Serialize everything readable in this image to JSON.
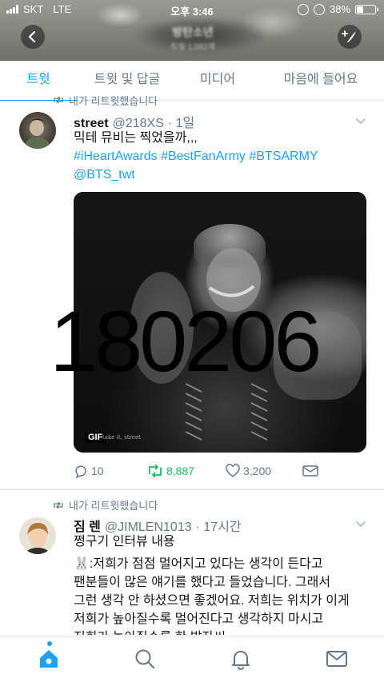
{
  "status_bar": {
    "carrier": "SKT",
    "network": "LTE",
    "time": "오후 3:46",
    "battery": "38%",
    "battery_level": 0.38
  },
  "header": {
    "title": "방탄소년",
    "subtitle": "트윗 1,082개"
  },
  "tabs": [
    {
      "label": "트윗",
      "active": true
    },
    {
      "label": "트윗 및 답글",
      "active": false
    },
    {
      "label": "미디어",
      "active": false
    },
    {
      "label": "마음에 들어요",
      "active": false
    }
  ],
  "tweets": [
    {
      "retweet_notice": "내가 리트윗했습니다",
      "name": "street",
      "handle": "@218XS",
      "time": "· 1일",
      "text": "믹테 뮤비는 찍었을까,,,",
      "hashtags": "#iHeartAwards #BestFanArmy #BTSARMY",
      "mention": "@BTS_twt",
      "gif_label": "GIF",
      "gif_caption": "take it, street",
      "replies": "10",
      "retweets": "8,887",
      "likes": "3,200",
      "retweeted": true
    },
    {
      "retweet_notice": "내가 리트윗했습니다",
      "name": "짐 렌",
      "handle": "@JIMLEN1013",
      "time": "· 17시간",
      "lines": [
        "쩡구기 인터뷰 내용",
        "🐰:저희가 점점 멀어지고 있다는 생각이 든다고",
        "팬분들이 많은 얘기를 했다고 들었습니다. 그래서",
        "그런 생각 안 하셨으면 좋겠어요. 저희는 위치가 이게",
        "저희가 높아질수록 멀어진다고 생각하지 마시고",
        "저희가 높아질수록 한 발자씨"
      ]
    }
  ],
  "overlay_text": "180206",
  "colors": {
    "accent": "#1da1f2",
    "retweet": "#17bf63",
    "muted": "#657786"
  },
  "icons": [
    "back-icon",
    "compose-icon",
    "reply-icon",
    "retweet-icon",
    "like-icon",
    "dm-icon",
    "home-icon",
    "search-icon",
    "notifications-icon",
    "messages-icon"
  ]
}
